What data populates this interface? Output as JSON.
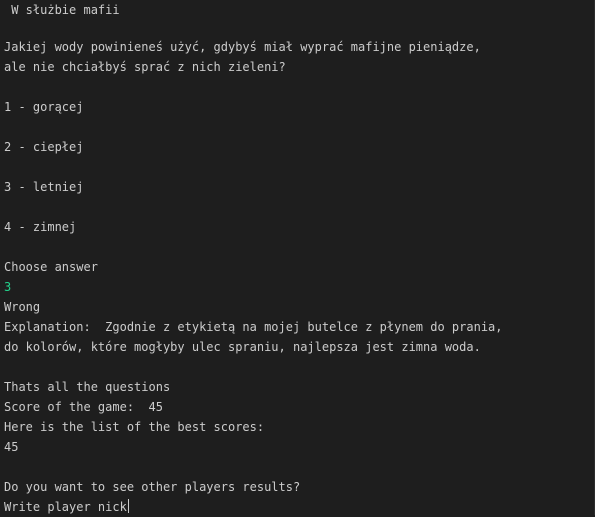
{
  "terminal": {
    "title": " W służbie mafii",
    "question_line1": "Jakiej wody powinieneś użyć, gdybyś miał wyprać mafijne pieniądze,",
    "question_line2": "ale nie chciałbyś sprać z nich zieleni?",
    "option1": "1 - gorącej",
    "option2": "2 - ciepłej",
    "option3": "3 - letniej",
    "option4": "4 - zimnej",
    "prompt_choose": "Choose answer",
    "user_answer": "3",
    "result": "Wrong",
    "explanation_line1": "Explanation:  Zgodnie z etykietą na mojej butelce z płynem do prania,",
    "explanation_line2": "do kolorów, które mogłyby ulec spraniu, najlepsza jest zimna woda.",
    "end_message": "Thats all the questions",
    "score_line": "Score of the game:  45",
    "best_scores_header": "Here is the list of the best scores:",
    "best_score_1": "45",
    "see_others_prompt": "Do you want to see other players results?",
    "write_nick_prompt": "Write player nick"
  },
  "colors": {
    "background": "#1e1e1e",
    "text": "#cccccc",
    "user_input": "#23d18b"
  }
}
